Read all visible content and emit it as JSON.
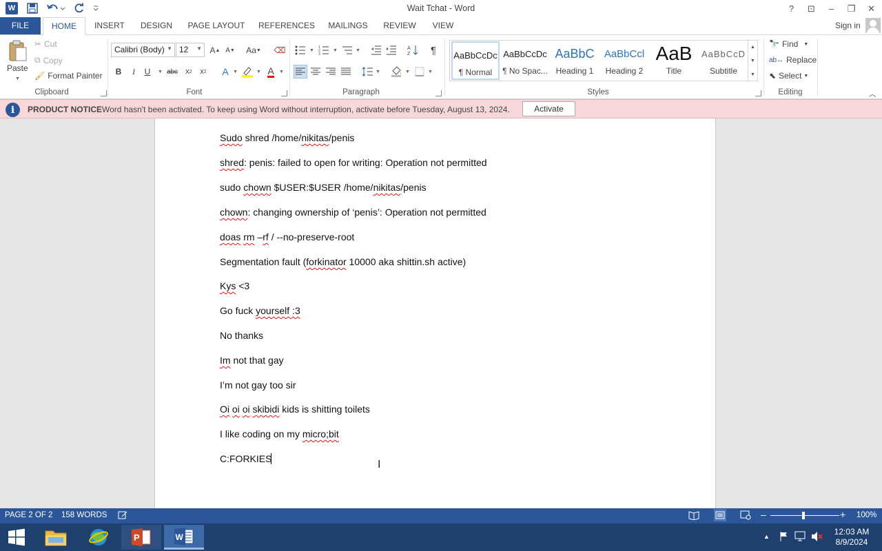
{
  "window": {
    "title": "Wait Tchat - Word",
    "controls": {
      "help": "?",
      "restore_ribbon": "⊡",
      "minimize": "–",
      "maximize": "❐",
      "close": "✕"
    }
  },
  "quick_access": {
    "word_logo": "W"
  },
  "tabs": [
    {
      "label": "FILE"
    },
    {
      "label": "HOME",
      "active": true
    },
    {
      "label": "INSERT"
    },
    {
      "label": "DESIGN"
    },
    {
      "label": "PAGE LAYOUT"
    },
    {
      "label": "REFERENCES"
    },
    {
      "label": "MAILINGS"
    },
    {
      "label": "REVIEW"
    },
    {
      "label": "VIEW"
    }
  ],
  "account": {
    "sign_in": "Sign in"
  },
  "ribbon": {
    "clipboard": {
      "label": "Clipboard",
      "paste": "Paste",
      "cut": "Cut",
      "copy": "Copy",
      "format_painter": "Format Painter"
    },
    "font": {
      "label": "Font",
      "font_name": "Calibri (Body)",
      "font_size": "12"
    },
    "paragraph": {
      "label": "Paragraph"
    },
    "styles": {
      "label": "Styles",
      "items": [
        {
          "preview": "AaBbCcDc",
          "name": "¶ Normal"
        },
        {
          "preview": "AaBbCcDc",
          "name": "¶ No Spac..."
        },
        {
          "preview": "AaBbC",
          "name": "Heading 1"
        },
        {
          "preview": "AaBbCcl",
          "name": "Heading 2"
        },
        {
          "preview": "AaB",
          "name": "Title"
        },
        {
          "preview": "AaBbCcD",
          "name": "Subtitle"
        }
      ]
    },
    "editing": {
      "label": "Editing",
      "find": "Find",
      "replace": "Replace",
      "select": "Select"
    }
  },
  "notice": {
    "title": "PRODUCT NOTICE",
    "message": "Word hasn't been activated. To keep using Word without interruption, activate before Tuesday, August 13, 2024.",
    "button": "Activate"
  },
  "document": {
    "lines": [
      "Sudo shred /home/nikitas/penis",
      "shred: penis: failed to open for writing: Operation not permitted",
      "sudo chown $USER:$USER /home/nikitas/penis",
      "chown: changing ownership of ‘penis’: Operation not permitted",
      "doas rm –rf / --no-preserve-root",
      "Segmentation fault (forkinator 10000 aka shittin.sh active)",
      "Kys <3",
      "Go fuck yourself :3",
      "No thanks",
      "Im not that gay",
      "I’m not gay too sir",
      "Oi oi oi skibidi kids is shitting toilets",
      "I like coding on my micro;bit",
      "C:FORKIES"
    ]
  },
  "status": {
    "page": "PAGE 2 OF 2",
    "words": "158 WORDS",
    "zoom": "100%",
    "zoom_level_percent": 100
  },
  "taskbar": {
    "time": "12:03 AM",
    "date": "8/9/2024"
  },
  "colors": {
    "accent": "#2b579a",
    "notice_bg": "#f8d7da",
    "taskbar": "#1f3f6f"
  }
}
